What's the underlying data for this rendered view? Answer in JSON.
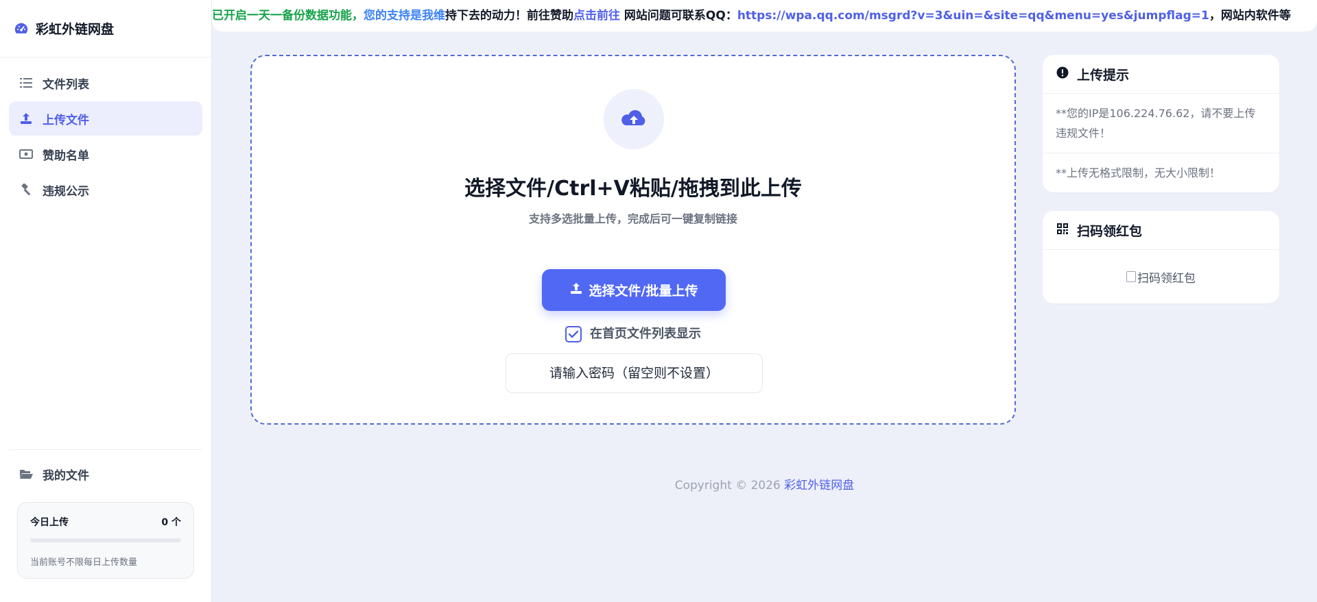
{
  "brand": {
    "name": "彩虹外链网盘"
  },
  "nav": [
    {
      "label": "文件列表",
      "icon": "list-icon",
      "active": false
    },
    {
      "label": "上传文件",
      "icon": "upload-icon",
      "active": true
    },
    {
      "label": "赞助名单",
      "icon": "money-icon",
      "active": false
    },
    {
      "label": "违规公示",
      "icon": "hammer-icon",
      "active": false
    }
  ],
  "sidebar_bottom": {
    "my_files": "我的文件",
    "today_label": "今日上传",
    "today_value": "0 个",
    "today_progress": 0,
    "note": "当前账号不限每日上传数量"
  },
  "ticker": {
    "segment1": "已开启一天一备份数据功能，",
    "segment2": "您的支持是我维",
    "segment3": "持下去的动力！前往赞助",
    "segment4": "点击前往",
    "segment5": " 网站问题可联系QQ：",
    "segment6": "https://wpa.qq.com/msgrd?v=3&uin=&site=qq&menu=yes&jumpflag=1",
    "segment7": "，网站内软件等"
  },
  "upload": {
    "title": "选择文件/Ctrl+V粘贴/拖拽到此上传",
    "subtitle": "支持多选批量上传，完成后可一键复制链接",
    "button_label": "选择文件/批量上传",
    "checkbox_label": "在首页文件列表显示",
    "checkbox_checked": true,
    "password_placeholder": "请输入密码（留空则不设置）",
    "password_value": ""
  },
  "tips_card": {
    "title": "上传提示",
    "lines": [
      "**您的IP是106.224.76.62，请不要上传违规文件！",
      "**上传无格式限制，无大小限制！"
    ]
  },
  "qr_card": {
    "title": "扫码领红包",
    "image_alt": "扫码领红包"
  },
  "footer": {
    "copyright": "Copyright © 2026 ",
    "site_link": "彩虹外链网盘"
  },
  "colors": {
    "accent": "#4f5fe8",
    "button": "#5168f5",
    "background": "#eef0f9"
  }
}
